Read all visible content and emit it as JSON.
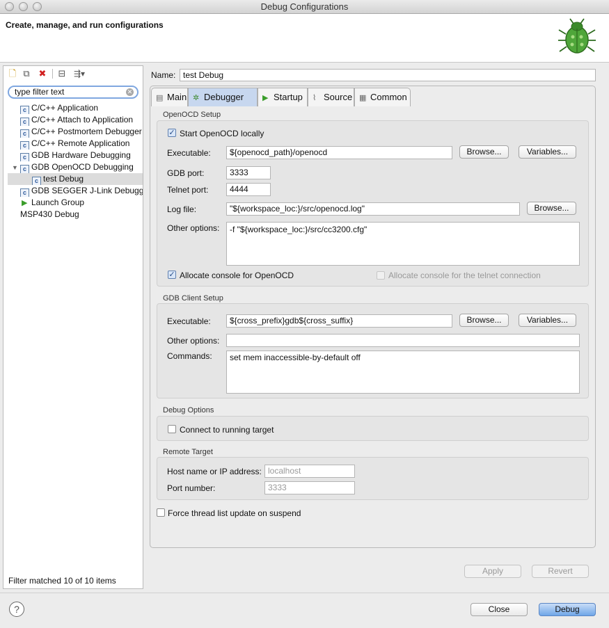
{
  "window": {
    "title": "Debug Configurations"
  },
  "header": {
    "title": "Create, manage, and run configurations",
    "logo_icon": "bug-icon"
  },
  "left_panel": {
    "toolbar": [
      "new-config-icon",
      "duplicate-icon",
      "delete-icon",
      "collapse-all-icon",
      "filter-icon"
    ],
    "filter_text": "type filter text",
    "tree": [
      {
        "label": "C/C++ Application",
        "icon": "c-icon"
      },
      {
        "label": "C/C++ Attach to Application",
        "icon": "c-icon"
      },
      {
        "label": "C/C++ Postmortem Debugger",
        "icon": "c-icon"
      },
      {
        "label": "C/C++ Remote Application",
        "icon": "c-icon"
      },
      {
        "label": "GDB Hardware Debugging",
        "icon": "c-icon"
      },
      {
        "label": "GDB OpenOCD Debugging",
        "icon": "c-icon",
        "expanded": true
      },
      {
        "label": "test Debug",
        "icon": "c-icon",
        "child": true,
        "selected": true
      },
      {
        "label": "GDB SEGGER J-Link Debugging",
        "icon": "c-icon"
      },
      {
        "label": "Launch Group",
        "icon": "play-icon"
      },
      {
        "label": "MSP430 Debug",
        "icon": ""
      }
    ],
    "footer": "Filter matched 10 of 10 items"
  },
  "config": {
    "name_label": "Name:",
    "name_value": "test Debug",
    "tabs": [
      "Main",
      "Debugger",
      "Startup",
      "Source",
      "Common"
    ],
    "active_tab": "Debugger"
  },
  "openocd": {
    "title": "OpenOCD Setup",
    "start_locally": "Start OpenOCD locally",
    "executable_label": "Executable:",
    "executable_value": "${openocd_path}/openocd",
    "browse": "Browse...",
    "variables": "Variables...",
    "gdb_port_label": "GDB port:",
    "gdb_port_value": "3333",
    "telnet_port_label": "Telnet port:",
    "telnet_port_value": "4444",
    "log_file_label": "Log file:",
    "log_file_value": "\"${workspace_loc:}/src/openocd.log\"",
    "other_options_label": "Other options:",
    "other_options_value": "-f \"${workspace_loc:}/src/cc3200.cfg\"",
    "allocate_console": "Allocate console for OpenOCD",
    "allocate_telnet": "Allocate console for the telnet connection"
  },
  "gdb_client": {
    "title": "GDB Client Setup",
    "executable_label": "Executable:",
    "executable_value": "${cross_prefix}gdb${cross_suffix}",
    "other_options_label": "Other options:",
    "other_options_value": "",
    "commands_label": "Commands:",
    "commands_value": "set mem inaccessible-by-default off"
  },
  "debug_options": {
    "title": "Debug Options",
    "connect_running": "Connect to running target"
  },
  "remote_target": {
    "title": "Remote Target",
    "host_label": "Host name or IP address:",
    "host_value": "localhost",
    "port_label": "Port number:",
    "port_value": "3333"
  },
  "force_thread": "Force thread list update on suspend",
  "buttons": {
    "apply": "Apply",
    "revert": "Revert",
    "close": "Close",
    "debug": "Debug",
    "help": "?"
  }
}
